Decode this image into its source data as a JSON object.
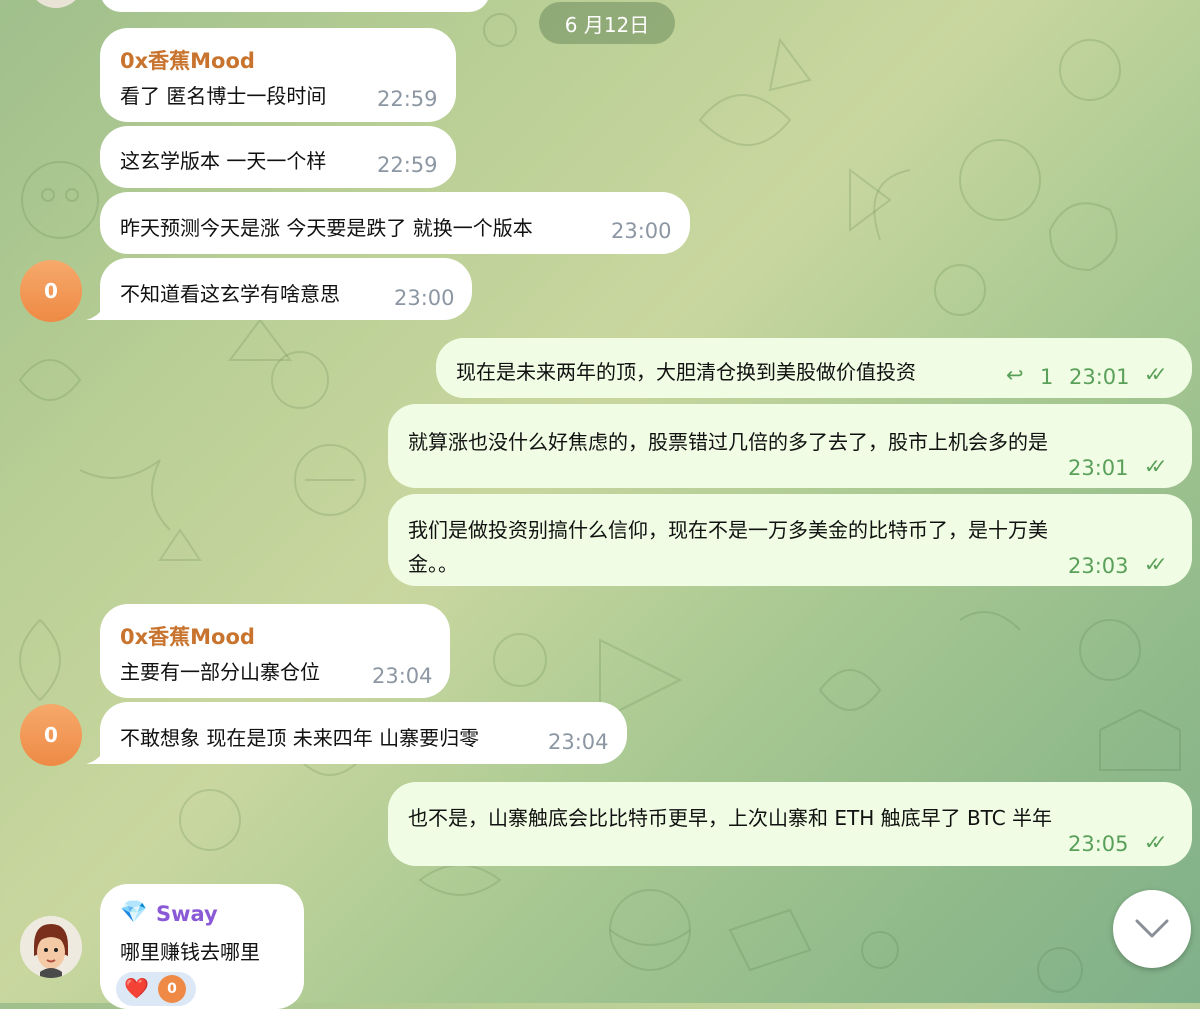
{
  "date": "6 月12日",
  "messages": [
    {
      "sender": "0x香蕉Mood",
      "text": "看了 匿名博士一段时间",
      "time": "22:59"
    },
    {
      "text": "这玄学版本 一天一个样",
      "time": "22:59"
    },
    {
      "text": "昨天预测今天是涨 今天要是跌了 就换一个版本",
      "time": "23:00"
    },
    {
      "text": "不知道看这玄学有啥意思",
      "time": "23:00",
      "avatar": "0"
    },
    {
      "text": "现在是未来两年的顶，大胆清仓换到美股做价值投资",
      "reply_count": "1",
      "time": "23:01"
    },
    {
      "text": "就算涨也没什么好焦虑的，股票错过几倍的多了去了，股市上机会多的是",
      "time": "23:01"
    },
    {
      "text_line1": "我们是做投资别搞什么信仰，现在不是一万多美金的比特币了，是十万美",
      "text_line2": "金。。",
      "time": "23:03"
    },
    {
      "sender": "0x香蕉Mood",
      "text": "主要有一部分山寨仓位",
      "time": "23:04"
    },
    {
      "text": "不敢想象 现在是顶 未来四年 山寨要归零",
      "time": "23:04",
      "avatar": "0"
    },
    {
      "text": "也不是，山寨触底会比比特币更早，上次山寨和 ETH 触底早了 BTC 半年",
      "time": "23:05"
    },
    {
      "sender": "Sway",
      "sender_emoji": "💎",
      "text": "哪里赚钱去哪里",
      "reaction_emoji": "❤️",
      "reaction_avatar": "0"
    }
  ],
  "colors": {
    "sender_orange": "#c8742e",
    "sender_purple": "#8a5ad6",
    "check_green": "#5aa05a"
  }
}
